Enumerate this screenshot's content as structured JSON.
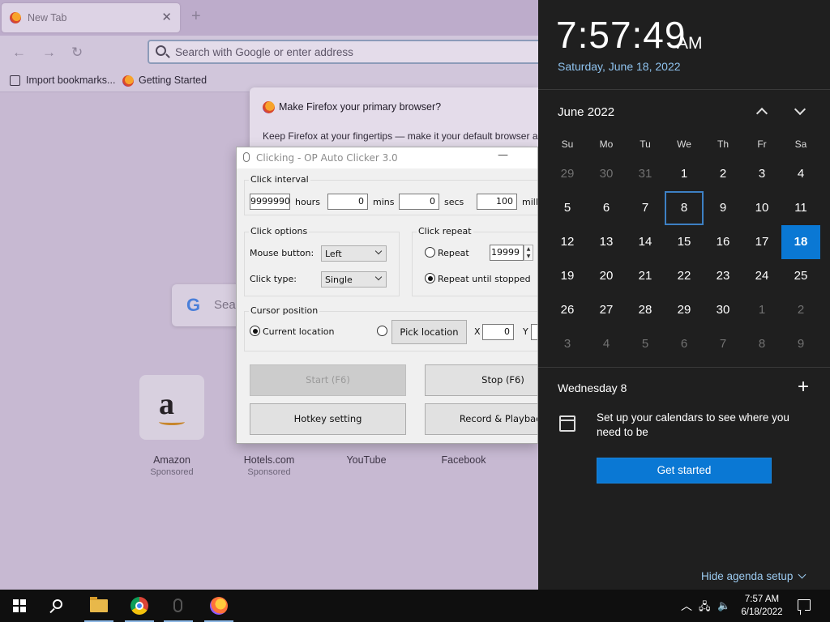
{
  "browser": {
    "tab_title": "New Tab",
    "tab_close": "✕",
    "new_tab": "+",
    "nav": {
      "back": "←",
      "forward": "→",
      "reload": "↻"
    },
    "url_placeholder": "Search with Google or enter address",
    "bookmarks": [
      "Import bookmarks...",
      "Getting Started"
    ],
    "google_search_placeholder": "Sear",
    "top_sites": [
      {
        "name": "Amazon",
        "label": "Sponsored"
      },
      {
        "name": "Hotels.com",
        "label": "Sponsored"
      },
      {
        "name": "YouTube",
        "label": ""
      },
      {
        "name": "Facebook",
        "label": ""
      }
    ]
  },
  "default_prompt": {
    "heading": "Make Firefox your primary browser?",
    "body": "Keep Firefox at your fingertips — make it your default browser ar"
  },
  "auto_clicker": {
    "title": "Clicking - OP Auto Clicker 3.0",
    "minimize": "—",
    "click_interval": {
      "label": "Click interval",
      "hours": "9999990",
      "hours_label": "hours",
      "mins": "0",
      "mins_label": "mins",
      "secs": "0",
      "secs_label": "secs",
      "millis": "100",
      "millis_label": "millis"
    },
    "click_options": {
      "label": "Click options",
      "mouse_button_label": "Mouse button:",
      "mouse_button": "Left",
      "click_type_label": "Click type:",
      "click_type": "Single"
    },
    "click_repeat": {
      "label": "Click repeat",
      "repeat_label": "Repeat",
      "repeat_value": "19999",
      "until_stopped_label": "Repeat until stopped",
      "selected": "until_stopped"
    },
    "cursor_position": {
      "label": "Cursor position",
      "current_label": "Current location",
      "pick_label": "Pick location",
      "x_label": "X",
      "x": "0",
      "y_label": "Y"
    },
    "buttons": {
      "start": "Start (F6)",
      "stop": "Stop (F6)",
      "hotkey": "Hotkey setting",
      "record": "Record & Playback"
    }
  },
  "clock": {
    "time": "7:57:49",
    "ampm": "AM",
    "date": "Saturday, June 18, 2022"
  },
  "calendar": {
    "month": "June 2022",
    "weekdays": [
      "Su",
      "Mo",
      "Tu",
      "We",
      "Th",
      "Fr",
      "Sa"
    ],
    "weeks": [
      [
        "29",
        "30",
        "31",
        "1",
        "2",
        "3",
        "4"
      ],
      [
        "5",
        "6",
        "7",
        "8",
        "9",
        "10",
        "11"
      ],
      [
        "12",
        "13",
        "14",
        "15",
        "16",
        "17",
        "18"
      ],
      [
        "19",
        "20",
        "21",
        "22",
        "23",
        "24",
        "25"
      ],
      [
        "26",
        "27",
        "28",
        "29",
        "30",
        "1",
        "2"
      ],
      [
        "3",
        "4",
        "5",
        "6",
        "7",
        "8",
        "9"
      ]
    ],
    "selected_day": "8",
    "today": "18"
  },
  "agenda": {
    "heading": "Wednesday 8",
    "add": "+",
    "message": "Set up your calendars to see where you need to be",
    "get_started": "Get started",
    "hide": "Hide agenda setup"
  },
  "taskbar": {
    "time": "7:57 AM",
    "date": "6/18/2022",
    "colors": {
      "accent": "#0a78d4",
      "taskbar": "#0f0f0f",
      "flyout": "#1f1f1f"
    }
  }
}
